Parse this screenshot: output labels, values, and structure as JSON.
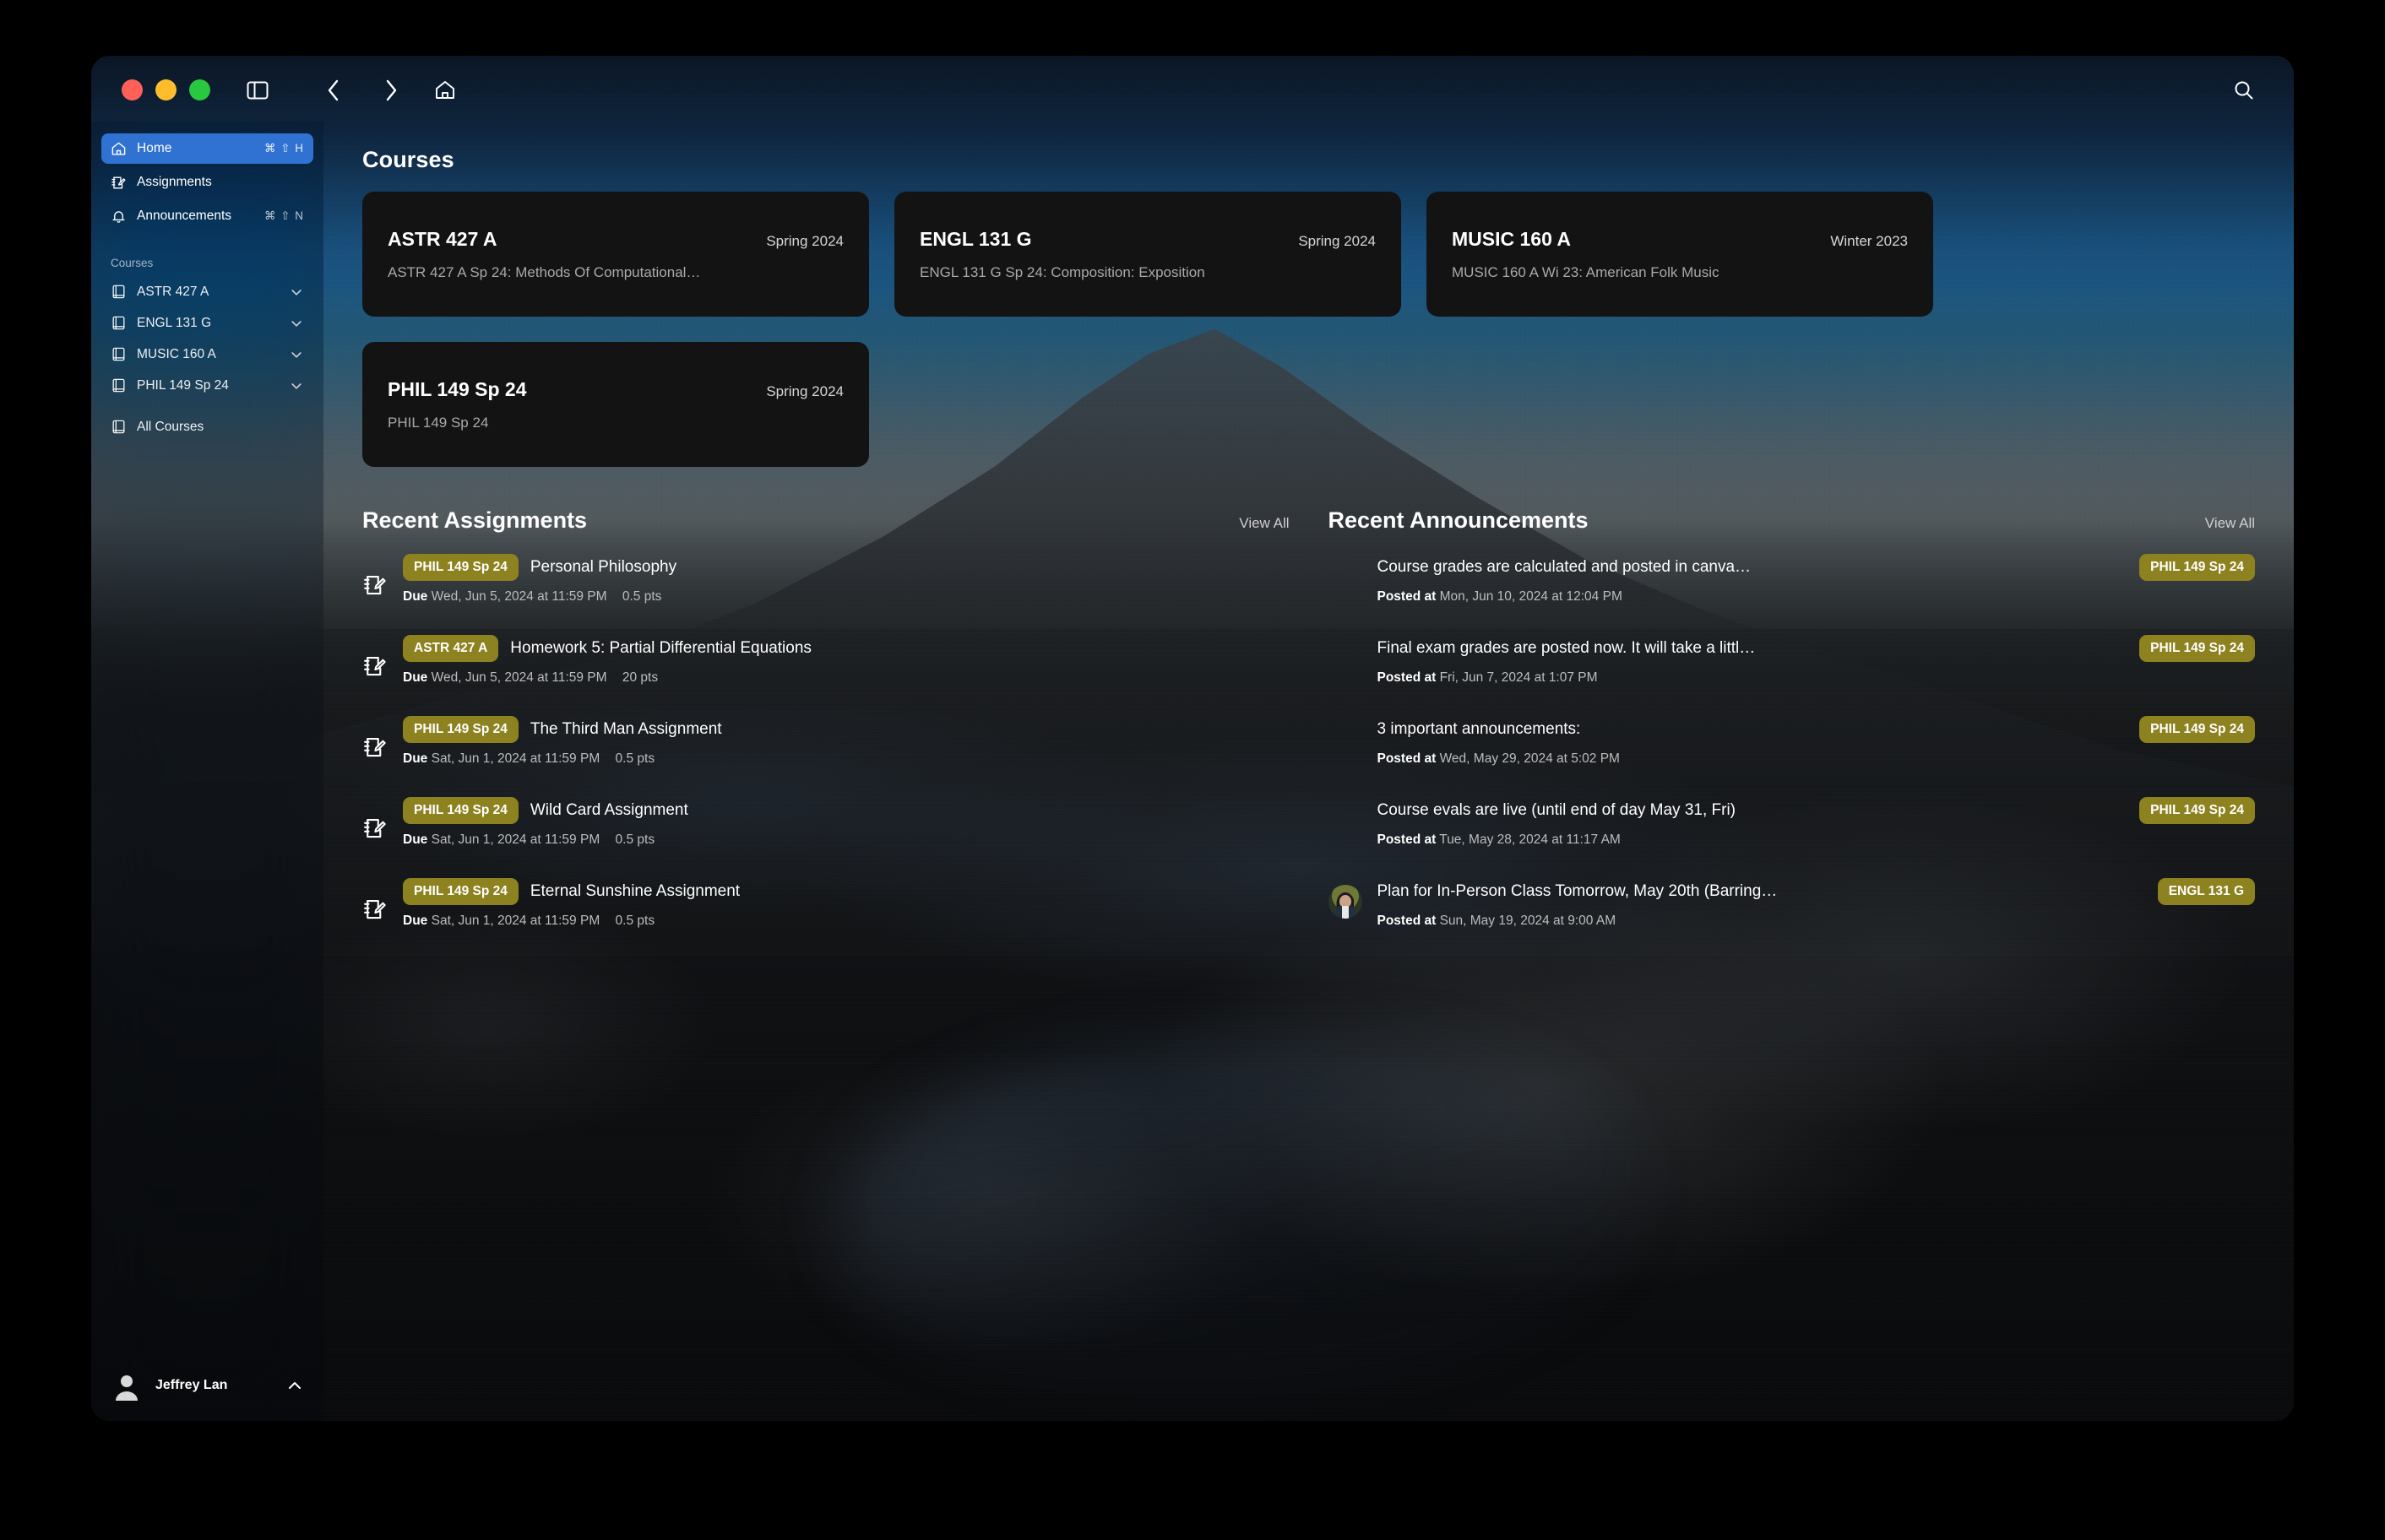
{
  "titlebar": {
    "traffic": {
      "close": "close",
      "minimize": "minimize",
      "maximize": "maximize"
    },
    "sidebar_toggle": "sidebar-toggle",
    "back": "back",
    "forward": "forward",
    "home": "home",
    "search": "search"
  },
  "sidebar": {
    "nav": [
      {
        "label": "Home",
        "icon": "home-icon",
        "shortcut": "⌘ ⇧ H",
        "active": true
      },
      {
        "label": "Assignments",
        "icon": "assignment-icon",
        "shortcut": "",
        "active": false
      },
      {
        "label": "Announcements",
        "icon": "bell-icon",
        "shortcut": "⌘ ⇧ N",
        "active": false
      }
    ],
    "courses_heading": "Courses",
    "courses": [
      {
        "label": "ASTR 427 A"
      },
      {
        "label": "ENGL 131 G"
      },
      {
        "label": "MUSIC 160 A"
      },
      {
        "label": "PHIL 149 Sp 24"
      }
    ],
    "all_courses": {
      "label": "All Courses"
    },
    "profile": {
      "name": "Jeffrey Lan"
    }
  },
  "main": {
    "courses_title": "Courses",
    "course_cards": [
      {
        "code": "ASTR 427 A",
        "term": "Spring 2024",
        "desc": "ASTR 427 A Sp 24: Methods Of Computational…"
      },
      {
        "code": "ENGL 131 G",
        "term": "Spring 2024",
        "desc": "ENGL 131 G Sp 24: Composition: Exposition"
      },
      {
        "code": "MUSIC 160 A",
        "term": "Winter 2023",
        "desc": "MUSIC 160 A Wi 23: American Folk Music"
      },
      {
        "code": "PHIL 149 Sp 24",
        "term": "Spring 2024",
        "desc": "PHIL 149 Sp 24"
      }
    ],
    "assignments": {
      "title": "Recent Assignments",
      "view_all": "View All",
      "items": [
        {
          "badge": "PHIL 149 Sp 24",
          "title": "Personal Philosophy",
          "due_label": "Due",
          "due": "Wed, Jun 5, 2024 at 11:59 PM",
          "points": "0.5 pts"
        },
        {
          "badge": "ASTR 427 A",
          "title": "Homework 5: Partial Differential Equations",
          "due_label": "Due",
          "due": "Wed, Jun 5, 2024 at 11:59 PM",
          "points": "20 pts"
        },
        {
          "badge": "PHIL 149 Sp 24",
          "title": "The Third Man Assignment",
          "due_label": "Due",
          "due": "Sat, Jun 1, 2024 at 11:59 PM",
          "points": "0.5 pts"
        },
        {
          "badge": "PHIL 149 Sp 24",
          "title": "Wild Card Assignment",
          "due_label": "Due",
          "due": "Sat, Jun 1, 2024 at 11:59 PM",
          "points": "0.5 pts"
        },
        {
          "badge": "PHIL 149 Sp 24",
          "title": "Eternal Sunshine Assignment",
          "due_label": "Due",
          "due": "Sat, Jun 1, 2024 at 11:59 PM",
          "points": "0.5 pts"
        }
      ]
    },
    "announcements": {
      "title": "Recent Announcements",
      "view_all": "View All",
      "items": [
        {
          "title": "Course grades are calculated and posted in canva…",
          "badge": "PHIL 149 Sp 24",
          "posted_label": "Posted at",
          "posted": "Mon, Jun 10, 2024 at 12:04 PM",
          "avatar": false
        },
        {
          "title": "Final exam grades are posted now. It will take a littl…",
          "badge": "PHIL 149 Sp 24",
          "posted_label": "Posted at",
          "posted": "Fri, Jun 7, 2024 at 1:07 PM",
          "avatar": false
        },
        {
          "title": "3 important announcements:",
          "badge": "PHIL 149 Sp 24",
          "posted_label": "Posted at",
          "posted": "Wed, May 29, 2024 at 5:02 PM",
          "avatar": false
        },
        {
          "title": "Course evals are live (until end of day May 31, Fri)",
          "badge": "PHIL 149 Sp 24",
          "posted_label": "Posted at",
          "posted": "Tue, May 28, 2024 at 11:17 AM",
          "avatar": false
        },
        {
          "title": "Plan for In-Person Class Tomorrow, May 20th (Barring…",
          "badge": "ENGL 131 G",
          "posted_label": "Posted at",
          "posted": "Sun, May 19, 2024 at 9:00 AM",
          "avatar": true
        }
      ]
    }
  },
  "colors": {
    "accent_blue": "#2f72d2",
    "badge_olive": "#8d8220",
    "card_bg": "#131313",
    "traffic_red": "#ff6159",
    "traffic_yellow": "#ffbd2e",
    "traffic_green": "#28c93f"
  }
}
